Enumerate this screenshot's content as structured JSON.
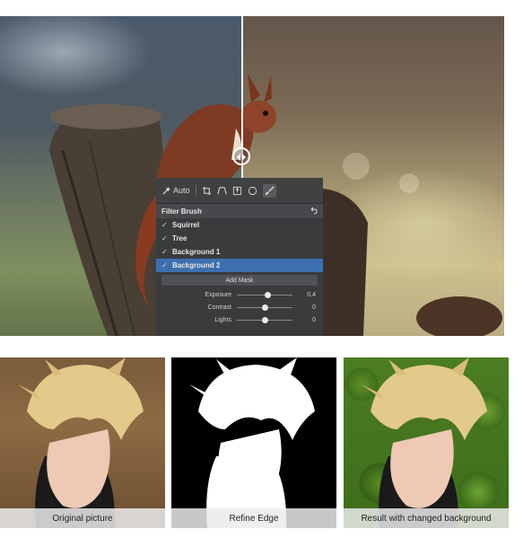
{
  "editor": {
    "toolbar": {
      "auto_label": "Auto",
      "icons": [
        "magic-wand-icon",
        "crop-icon",
        "perspective-icon",
        "export-icon",
        "circle-icon",
        "brush-icon"
      ]
    },
    "section_title": "Filter Brush",
    "masks": [
      {
        "label": "Squirrel",
        "checked": true,
        "selected": false
      },
      {
        "label": "Tree",
        "checked": true,
        "selected": false
      },
      {
        "label": "Background 1",
        "checked": true,
        "selected": false
      },
      {
        "label": "Background 2",
        "checked": true,
        "selected": true
      }
    ],
    "add_mask_label": "Add Mask",
    "sliders": [
      {
        "label": "Exposure",
        "value": "0.4",
        "level": 0.55
      },
      {
        "label": "Contrast",
        "value": "0",
        "level": 0.5
      },
      {
        "label": "Lights",
        "value": "0",
        "level": 0.5
      }
    ],
    "selected_color": "#3d6fb0"
  },
  "comparison": {
    "captions": [
      "Original picture",
      "Refine Edge",
      "Result with changed background"
    ]
  }
}
